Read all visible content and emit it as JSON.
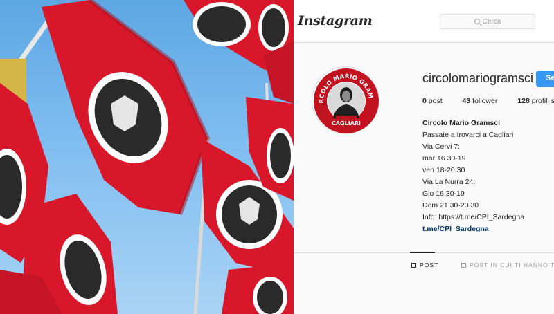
{
  "header": {
    "logo_text": "Instagram",
    "search_placeholder": "Cerca"
  },
  "avatar": {
    "badge_top_text": "CIRCOLO MARIO GRAMSCI",
    "badge_bottom_text": "CAGLIARI"
  },
  "profile": {
    "username": "circolomariogramsci",
    "follow_label": "Segui",
    "stats": {
      "posts_count": "0",
      "posts_label": "post",
      "followers_count": "43",
      "followers_label": "follower",
      "following_count": "128",
      "following_label": "profili seguiti"
    },
    "bio": {
      "name": "Circolo Mario Gramsci",
      "lines": [
        "Passate a trovarci a Cagliari",
        "Via Cervi 7:",
        "mar 16.30-19",
        "ven 18-20.30",
        "Via La Nurra 24:",
        "Gio 16.30-19",
        "Dom 21.30-23.30",
        "Info: https://t.me/CPI_Sardegna"
      ],
      "link": "t.me/CPI_Sardegna"
    }
  },
  "tabs": {
    "post": "POST",
    "tagged": "POST IN CUI TI HANNO TAGGATO"
  },
  "colors": {
    "flag_red": "#d8182a",
    "sky_blue": "#6fb2ea",
    "follow_blue": "#3897f0",
    "badge_red": "#c1121f"
  }
}
